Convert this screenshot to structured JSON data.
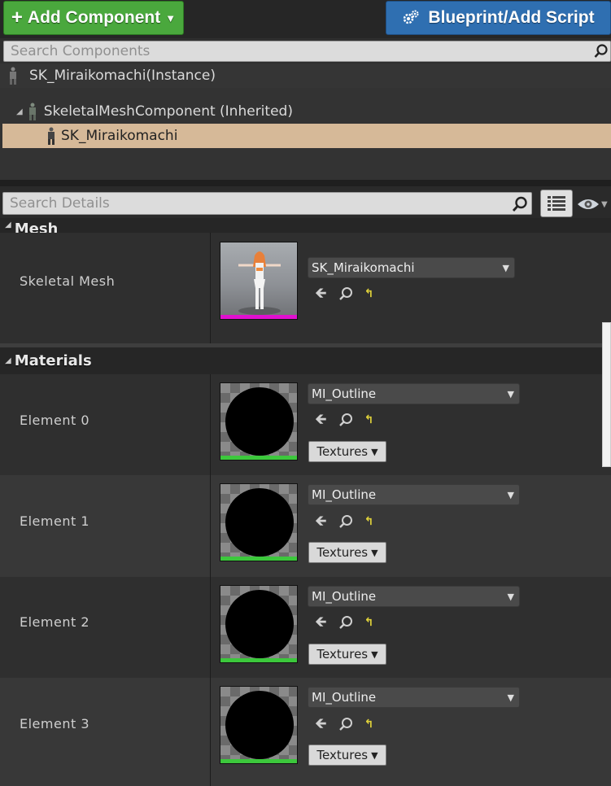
{
  "toolbar": {
    "add_component_label": "Add Component",
    "blueprint_label": "Blueprint/Add Script"
  },
  "components_search": {
    "placeholder": "Search Components"
  },
  "tree": {
    "root": "SK_Miraikomachi(Instance)",
    "inherited": "SkeletalMeshComponent (Inherited)",
    "selected": "SK_Miraikomachi"
  },
  "details_search": {
    "placeholder": "Search Details"
  },
  "mesh_section": {
    "title": "Mesh",
    "property_label": "Skeletal Mesh",
    "asset_value": "SK_Miraikomachi"
  },
  "materials_section": {
    "title": "Materials",
    "elements": [
      {
        "label": "Element 0",
        "value": "MI_Outline",
        "textures_label": "Textures"
      },
      {
        "label": "Element 1",
        "value": "MI_Outline",
        "textures_label": "Textures"
      },
      {
        "label": "Element 2",
        "value": "MI_Outline",
        "textures_label": "Textures"
      },
      {
        "label": "Element 3",
        "value": "MI_Outline",
        "textures_label": "Textures"
      }
    ]
  },
  "colors": {
    "add_button": "#4aa83d",
    "blueprint_button": "#2f6fb1",
    "selection": "#d6b998",
    "mesh_asset_bar": "#e010d0",
    "material_asset_bar": "#3cc83c"
  },
  "icons": [
    "plus-icon",
    "gears-icon",
    "search-icon",
    "mannequin-icon",
    "list-view-icon",
    "eye-icon",
    "use-selected-arrow-icon",
    "browse-magnifier-icon",
    "reset-to-default-icon"
  ]
}
